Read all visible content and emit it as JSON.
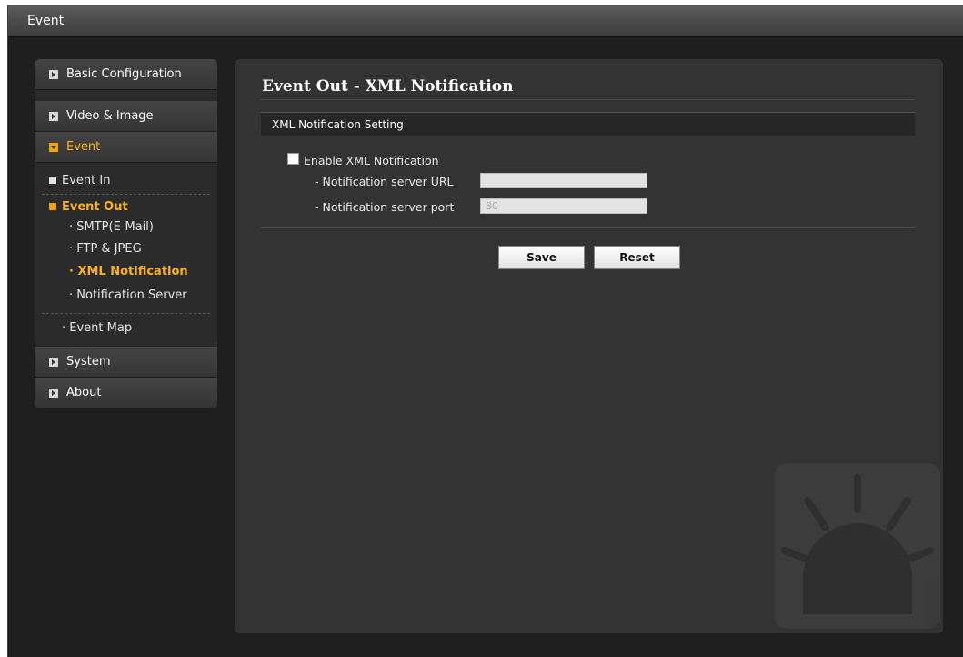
{
  "window": {
    "title": "Event"
  },
  "sidebar": {
    "sections": [
      {
        "label": "Basic Configuration"
      },
      {
        "label": "Video & Image"
      },
      {
        "label": "Event"
      },
      {
        "label": "System"
      },
      {
        "label": "About"
      }
    ],
    "event_items": {
      "event_in": "Event In",
      "event_out": "Event Out",
      "smtp": "SMTP(E-Mail)",
      "ftp": "FTP & JPEG",
      "xml": "XML Notification",
      "notification_server": "Notification Server",
      "event_map": "Event Map"
    }
  },
  "main": {
    "title": "Event Out - XML Notification",
    "section_header": "XML Notification Setting",
    "enable_label": "Enable XML Notification",
    "url_label": "- Notification server URL",
    "url_value": "",
    "port_label": "- Notification server port",
    "port_value": "80",
    "save_label": "Save",
    "reset_label": "Reset"
  },
  "colors": {
    "accent": "#f5a300",
    "panel": "#333333",
    "background": "#1f1f1f"
  }
}
